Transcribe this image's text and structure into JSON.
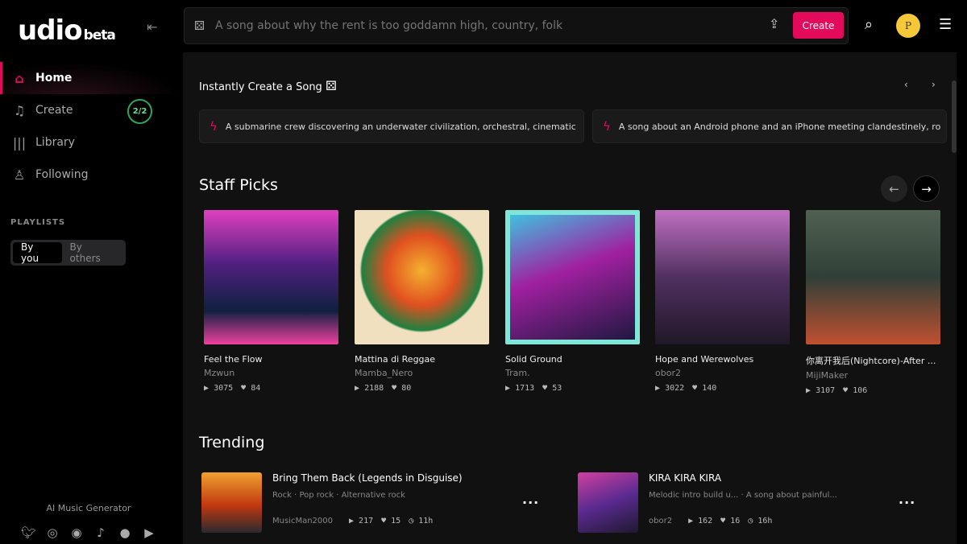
{
  "brand": {
    "name": "udio",
    "tag": "beta"
  },
  "sidebar": {
    "items": [
      {
        "label": "Home",
        "icon": "home-icon"
      },
      {
        "label": "Create",
        "icon": "music-plus-icon",
        "badge": "2/2"
      },
      {
        "label": "Library",
        "icon": "library-icon"
      },
      {
        "label": "Following",
        "icon": "user-icon"
      }
    ],
    "playlists_label": "PLAYLISTS",
    "seg": [
      "By you",
      "By others"
    ],
    "footer": "AI Music Generator",
    "social": [
      "twitter-icon",
      "instagram-icon",
      "discord-icon",
      "tiktok-icon",
      "reddit-icon",
      "youtube-icon"
    ]
  },
  "topbar": {
    "placeholder": "A song about why the rent is too goddamn high, country, folk",
    "create": "Create",
    "avatar": "P"
  },
  "instant": {
    "title": "Instantly Create a Song",
    "prompts": [
      "A submarine crew discovering an underwater civilization, orchestral, cinematic",
      "A song about an Android phone and an iPhone meeting clandestinely, ro"
    ]
  },
  "staff": {
    "title": "Staff Picks",
    "items": [
      {
        "title": "Feel the Flow",
        "artist": "Mzwun",
        "plays": "3075",
        "likes": "84"
      },
      {
        "title": "Mattina di Reggae",
        "artist": "Mamba_Nero",
        "plays": "2188",
        "likes": "80"
      },
      {
        "title": "Solid Ground",
        "artist": "Tram.",
        "plays": "1713",
        "likes": "53"
      },
      {
        "title": "Hope and Werewolves",
        "artist": "obor2",
        "plays": "3022",
        "likes": "140"
      },
      {
        "title": "你离开我后(Nightcore)-After ...",
        "artist": "MijiMaker",
        "plays": "3107",
        "likes": "106"
      }
    ]
  },
  "trending": {
    "title": "Trending",
    "items": [
      {
        "title": "Bring Them Back (Legends in Disguise)",
        "tags": "Rock  ·  Pop rock  ·  Alternative rock",
        "artist": "MusicMan2000",
        "plays": "217",
        "likes": "15",
        "age": "11h"
      },
      {
        "title": "KIRA KIRA KIRA",
        "tags": "Melodic intro build u...  ·  A song about painful...",
        "artist": "obor2",
        "plays": "162",
        "likes": "16",
        "age": "16h"
      }
    ]
  },
  "colors": {
    "accent": "#e30a5c",
    "badge": "#2fa35a"
  }
}
